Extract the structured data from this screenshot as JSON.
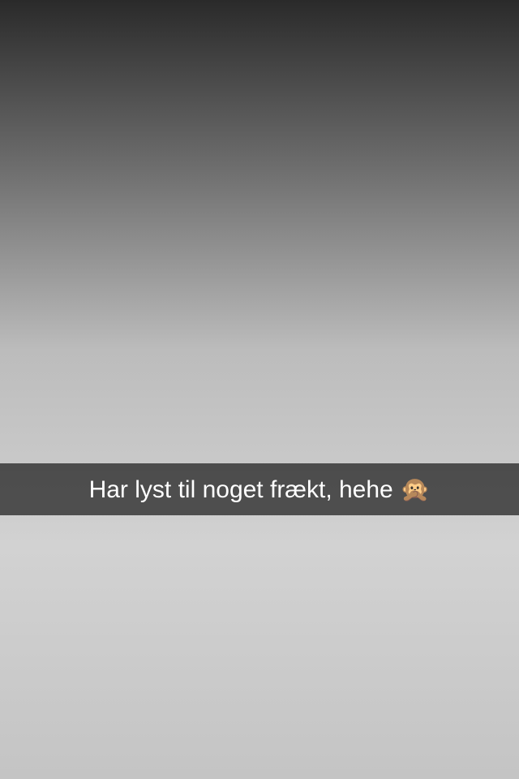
{
  "caption": {
    "text": "Har lyst til noget frækt, hehe 🙊"
  },
  "colors": {
    "caption_bar": "#000000",
    "caption_text": "#ffffff"
  }
}
